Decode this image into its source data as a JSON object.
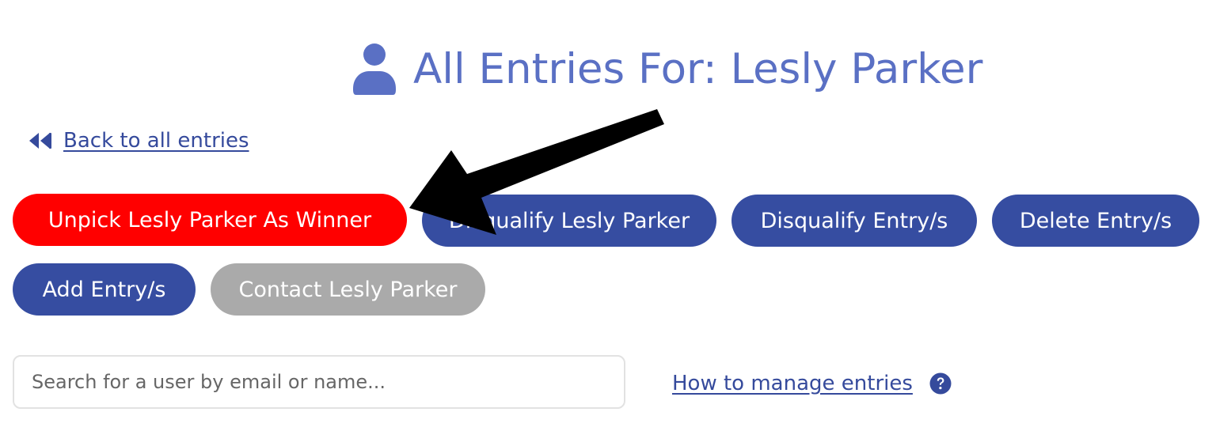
{
  "header": {
    "icon": "user-icon",
    "title": "All Entries For: Lesly Parker",
    "color": "#5a70c4"
  },
  "nav": {
    "back_icon": "rewind-icon",
    "back_label": "Back to all entries"
  },
  "actions": {
    "unpick_winner": "Unpick Lesly Parker As Winner",
    "disqualify_user": "Disqualify Lesly Parker",
    "disqualify_entries": "Disqualify Entry/s",
    "delete_entries": "Delete Entry/s",
    "add_entries": "Add Entry/s",
    "contact_user": "Contact Lesly Parker"
  },
  "search": {
    "placeholder": "Search for a user by email or name...",
    "value": ""
  },
  "help": {
    "label": "How to manage entries",
    "icon": "question-circle-icon"
  },
  "colors": {
    "primary": "#364da1",
    "danger": "#ff0000",
    "disabled": "#aaaaaa",
    "link": "#354a9c"
  }
}
